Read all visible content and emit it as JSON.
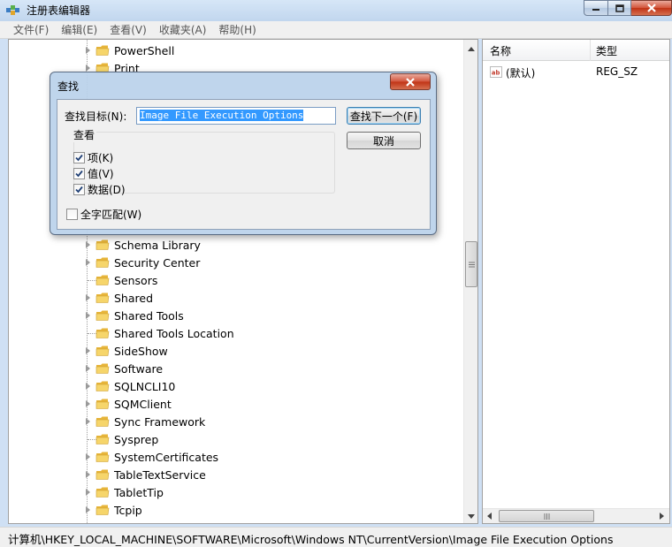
{
  "window": {
    "title": "注册表编辑器",
    "min_label": "minimize",
    "max_label": "maximize",
    "close_label": "close"
  },
  "menubar": {
    "items": [
      "文件(F)",
      "编辑(E)",
      "查看(V)",
      "收藏夹(A)",
      "帮助(H)"
    ]
  },
  "tree": {
    "rows": [
      {
        "label": "PowerShell",
        "expandable": true
      },
      {
        "label": "Print",
        "expandable": true
      },
      {
        "label": "Schema Library",
        "expandable": true
      },
      {
        "label": "Security Center",
        "expandable": true
      },
      {
        "label": "Sensors",
        "expandable": false
      },
      {
        "label": "Shared",
        "expandable": true
      },
      {
        "label": "Shared Tools",
        "expandable": true
      },
      {
        "label": "Shared Tools Location",
        "expandable": false
      },
      {
        "label": "SideShow",
        "expandable": true
      },
      {
        "label": "Software",
        "expandable": true
      },
      {
        "label": "SQLNCLI10",
        "expandable": true
      },
      {
        "label": "SQMClient",
        "expandable": true
      },
      {
        "label": "Sync Framework",
        "expandable": true
      },
      {
        "label": "Sysprep",
        "expandable": false
      },
      {
        "label": "SystemCertificates",
        "expandable": true
      },
      {
        "label": "TableTextService",
        "expandable": true
      },
      {
        "label": "TabletTip",
        "expandable": true
      },
      {
        "label": "Tcpip",
        "expandable": true
      }
    ]
  },
  "list": {
    "col_name": "名称",
    "col_type": "类型",
    "rows": [
      {
        "name": "(默认)",
        "type": "REG_SZ",
        "icon": "string-value-icon"
      }
    ]
  },
  "statusbar": {
    "path": "计算机\\HKEY_LOCAL_MACHINE\\SOFTWARE\\Microsoft\\Windows NT\\CurrentVersion\\Image File Execution Options"
  },
  "find_dialog": {
    "title": "查找",
    "find_label": "查找目标(N):",
    "find_value": "Image File Execution Options",
    "find_next_label": "查找下一个(F)",
    "cancel_label": "取消",
    "look_at_label": "查看",
    "opt_keys": "项(K)",
    "opt_values": "值(V)",
    "opt_data": "数据(D)",
    "opt_keys_checked": true,
    "opt_values_checked": true,
    "opt_data_checked": true,
    "match_whole_label": "全字匹配(W)",
    "match_whole_checked": false
  },
  "colors": {
    "accent": "#3399ff",
    "folder": "#f2c94c"
  }
}
